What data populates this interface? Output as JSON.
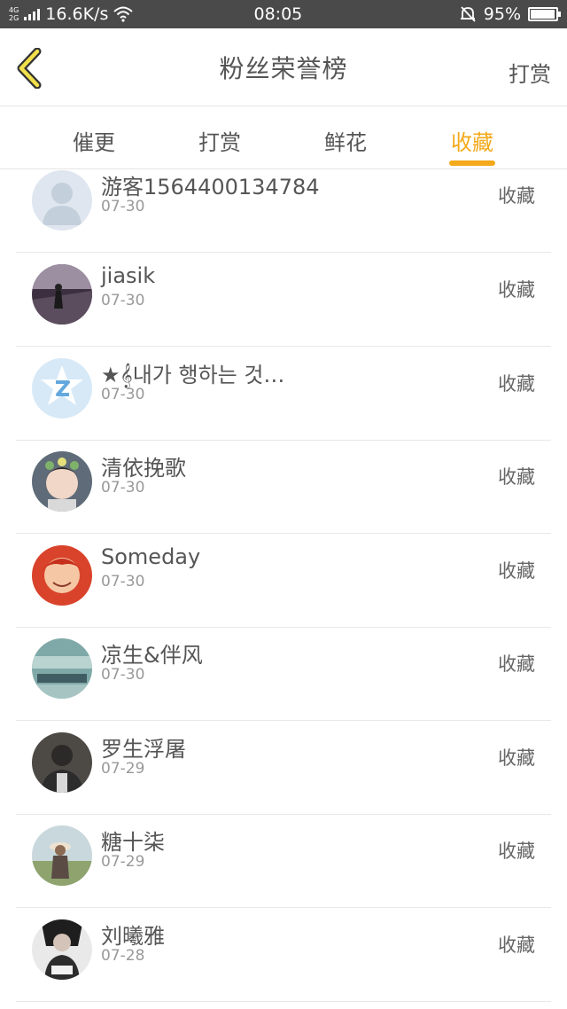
{
  "status_bar": {
    "network": "4G",
    "network2": "2G",
    "speed": "16.6K/s",
    "time": "08:05",
    "battery_level": "95%",
    "battery_fraction": 0.95
  },
  "header": {
    "back_icon": "chevron-left-icon",
    "title": "粉丝荣誉榜",
    "action": "打赏"
  },
  "tabs": [
    {
      "label": "催更",
      "active": false
    },
    {
      "label": "打赏",
      "active": false
    },
    {
      "label": "鲜花",
      "active": false
    },
    {
      "label": "收藏",
      "active": true
    }
  ],
  "accent_color": "#f3a91a",
  "rows": [
    {
      "name": "游客1564400134784",
      "date": "07-30",
      "action": "收藏",
      "avatar": "default-user-icon"
    },
    {
      "name": "jiasik",
      "date": "07-30",
      "action": "收藏",
      "avatar": "photo"
    },
    {
      "name": "★𝄞내가 행하는 것…",
      "date": "07-30",
      "action": "收藏",
      "avatar": "qq-logo-icon"
    },
    {
      "name": "清依挽歌",
      "date": "07-30",
      "action": "收藏",
      "avatar": "photo"
    },
    {
      "name": "Someday",
      "date": "07-30",
      "action": "收藏",
      "avatar": "anime-photo"
    },
    {
      "name": "凉生&伴风",
      "date": "07-30",
      "action": "收藏",
      "avatar": "photo"
    },
    {
      "name": "罗生浮屠",
      "date": "07-29",
      "action": "收藏",
      "avatar": "photo"
    },
    {
      "name": "糖十柒",
      "date": "07-29",
      "action": "收藏",
      "avatar": "photo"
    },
    {
      "name": "刘曦雅",
      "date": "07-28",
      "action": "收藏",
      "avatar": "photo"
    }
  ]
}
